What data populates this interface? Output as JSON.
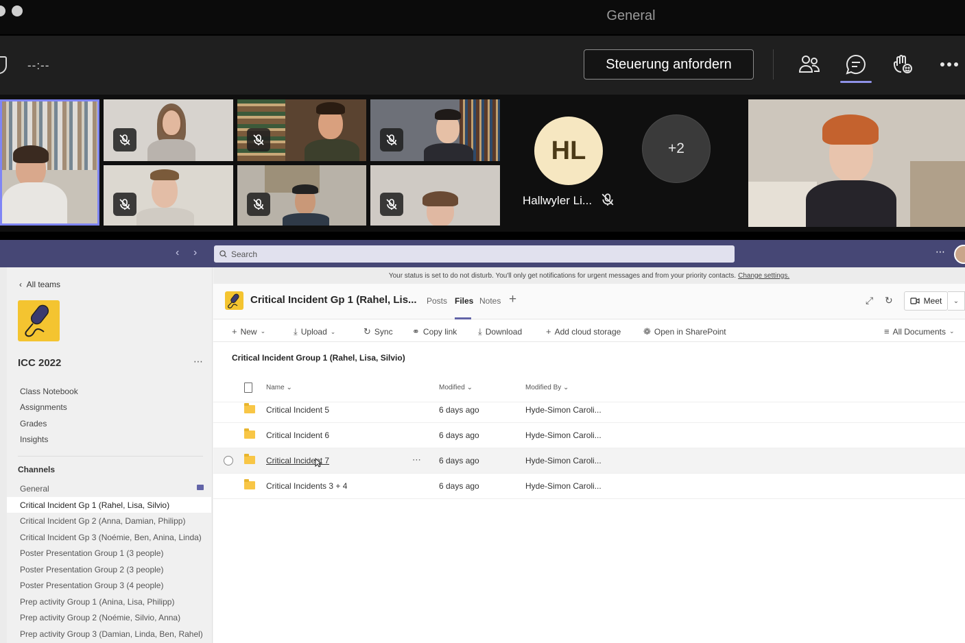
{
  "meeting": {
    "window_title": "General",
    "timer": "--:--",
    "control_button": "Steuerung anfordern",
    "participant_initials": "HL",
    "participant_name": "Hallwyler Li...",
    "overflow_count": "+2"
  },
  "teams": {
    "search_placeholder": "Search",
    "dnd_message": "Your status is set to do not disturb. You'll only get notifications for urgent messages and from your priority contacts.",
    "dnd_link": "Change settings.",
    "sidebar": {
      "back_label": "All teams",
      "team_name": "ICC 2022",
      "links": [
        "Class Notebook",
        "Assignments",
        "Grades",
        "Insights"
      ],
      "channels_heading": "Channels",
      "channels": [
        "General",
        "Critical Incident Gp 1 (Rahel, Lisa, Silvio)",
        "Critical Incident Gp 2 (Anna, Damian, Philipp)",
        "Critical Incident Gp 3 (Noémie, Ben, Anina, Linda)",
        "Poster Presentation Group 1 (3 people)",
        "Poster Presentation Group 2 (3 people)",
        "Poster Presentation Group 3 (4 people)",
        "Prep activity Group 1 (Anina, Lisa, Philipp)",
        "Prep activity Group 2 (Noémie, Silvio, Anna)",
        "Prep activity Group 3 (Damian, Linda, Ben, Rahel)"
      ]
    },
    "channel": {
      "title": "Critical Incident Gp 1 (Rahel, Lis...",
      "tabs": [
        "Posts",
        "Files",
        "Notes"
      ],
      "meet_label": "Meet"
    },
    "commands": {
      "new": "New",
      "upload": "Upload",
      "sync": "Sync",
      "copy_link": "Copy link",
      "download": "Download",
      "add_cloud": "Add cloud storage",
      "open_sharepoint": "Open in SharePoint",
      "view": "All Documents"
    },
    "breadcrumb": "Critical Incident Group 1 (Rahel, Lisa, Silvio)",
    "table": {
      "col_name": "Name",
      "col_modified": "Modified",
      "col_modified_by": "Modified By",
      "rows": [
        {
          "name": "Critical Incident 5",
          "modified": "6 days ago",
          "by": "Hyde-Simon Caroli..."
        },
        {
          "name": "Critical Incident 6",
          "modified": "6 days ago",
          "by": "Hyde-Simon Caroli..."
        },
        {
          "name": "Critical Incident 7",
          "modified": "6 days ago",
          "by": "Hyde-Simon Caroli..."
        },
        {
          "name": "Critical Incidents 3 + 4",
          "modified": "6 days ago",
          "by": "Hyde-Simon Caroli..."
        }
      ]
    }
  }
}
